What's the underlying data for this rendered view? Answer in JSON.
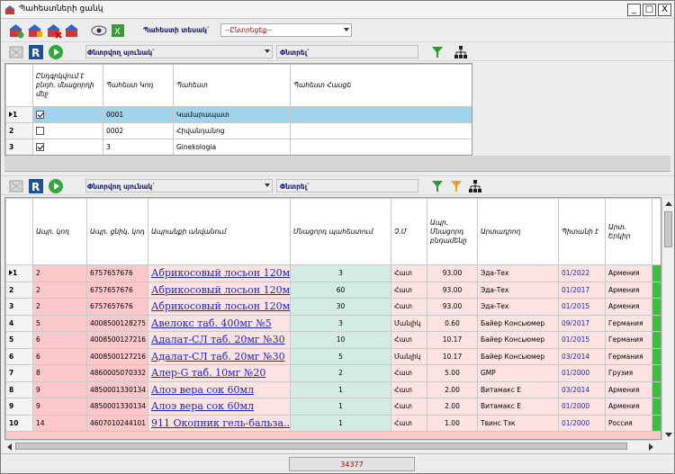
{
  "window": {
    "title": "Պահեստների ցանկ",
    "minimize": "_",
    "maximize": "□",
    "close": "X"
  },
  "toolbar": {
    "warehouse_type_label": "Պահեստի տեսակ`",
    "warehouse_type_value": "--Ընտրեցեք--",
    "search_column_label": "Փնտրվող սյունակ`",
    "search_label": "Փնտրել`",
    "search2_label": "Փնտրել`"
  },
  "top_table": {
    "headers": [
      "Ընդգրկվում է բնդհ. մնացորդի մեջ",
      "Պահեստ Կոդ",
      "Պահեստ",
      "Պահեստ Հասցե"
    ],
    "rows": [
      {
        "num": "1",
        "checked": true,
        "code": "0001",
        "name": "Կամարապատ",
        "address": ""
      },
      {
        "num": "2",
        "checked": false,
        "code": "0002",
        "name": "Հիվանդանոց",
        "address": ""
      },
      {
        "num": "3",
        "checked": true,
        "code": "3",
        "name": "Ginekologia",
        "address": ""
      }
    ]
  },
  "bottom_table": {
    "headers": [
      "Ապր. կոդ",
      "Ապր. ցնիկ. կոդ",
      "Ապրանքի անվանում",
      "Մնացորդ պահեստում",
      "Չ.Մ",
      "Ապր. Մնացորդ բնդամենը",
      "Արտադրող",
      "Պիտանի է",
      "Արտ. Երկիր",
      ""
    ],
    "rows": [
      {
        "num": "1",
        "code": "2",
        "barcode": "6757657676",
        "name": "Абрикосовый лосьон 120мл",
        "qty": "3",
        "unit": "Հատ",
        "total": "93.00",
        "maker": "Эда-Тех",
        "expiry": "01/2022",
        "country": "Армения",
        "g": ""
      },
      {
        "num": "2",
        "code": "2",
        "barcode": "6757657676",
        "name": "Абрикосовый лосьон 120мл",
        "qty": "60",
        "unit": "Հատ",
        "total": "93.00",
        "maker": "Эда-Тех",
        "expiry": "01/2017",
        "country": "Армения",
        "g": ""
      },
      {
        "num": "3",
        "code": "2",
        "barcode": "6757657676",
        "name": "Абрикосовый лосьон 120мл",
        "qty": "30",
        "unit": "Հատ",
        "total": "93.00",
        "maker": "Эда-Тех",
        "expiry": "01/2015",
        "country": "Армения",
        "g": ""
      },
      {
        "num": "4",
        "code": "5",
        "barcode": "4008500128275",
        "name": "Авелокс таб. 400мг №5",
        "qty": "3",
        "unit": "Մանլիկ",
        "total": "0.60",
        "maker": "Байер Консьюмер",
        "expiry": "09/2017",
        "country": "Германия",
        "g": ""
      },
      {
        "num": "5",
        "code": "6",
        "barcode": "4008500127216",
        "name": "Адалат-СЛ таб. 20мг №30",
        "qty": "10",
        "unit": "Հատ",
        "total": "10.17",
        "maker": "Байер Консьюмер",
        "expiry": "01/2015",
        "country": "Германия",
        "g": ""
      },
      {
        "num": "6",
        "code": "6",
        "barcode": "4008500127216",
        "name": "Адалат-СЛ таб. 20мг №30",
        "qty": "5",
        "unit": "Մանլիկ",
        "total": "10.17",
        "maker": "Байер Консьюмер",
        "expiry": "03/2014",
        "country": "Германия",
        "g": ""
      },
      {
        "num": "7",
        "code": "8",
        "barcode": "4860005070332",
        "name": "Алер-G таб. 10мг №20",
        "qty": "2",
        "unit": "Հատ",
        "total": "5.00",
        "maker": "GMP",
        "expiry": "01/2000",
        "country": "Грузия",
        "g": ""
      },
      {
        "num": "8",
        "code": "9",
        "barcode": "4850001330134",
        "name": "Алоэ вера сок 60мл",
        "qty": "1",
        "unit": "Հատ",
        "total": "2.00",
        "maker": "Витамакс Е",
        "expiry": "03/2014",
        "country": "Армения",
        "g": ""
      },
      {
        "num": "9",
        "code": "9",
        "barcode": "4850001330134",
        "name": "Алоэ вера сок 60мл",
        "qty": "1",
        "unit": "Հատ",
        "total": "2.00",
        "maker": "Витамакс Е",
        "expiry": "01/2000",
        "country": "Армения",
        "g": ""
      },
      {
        "num": "10",
        "code": "14",
        "barcode": "4607010244101",
        "name": "911 Окопник гель-бальза...",
        "qty": "1",
        "unit": "Հատ",
        "total": "1.00",
        "maker": "Твинс Тэк",
        "expiry": "01/2000",
        "country": "Россия",
        "g": ""
      }
    ]
  },
  "status": {
    "total": "34377"
  },
  "colors": {
    "selected": "#9fd4ec",
    "pink": "#fbc7c9",
    "mint": "#d2ece3",
    "link": "#1b26c8",
    "total_text": "#b30000"
  }
}
